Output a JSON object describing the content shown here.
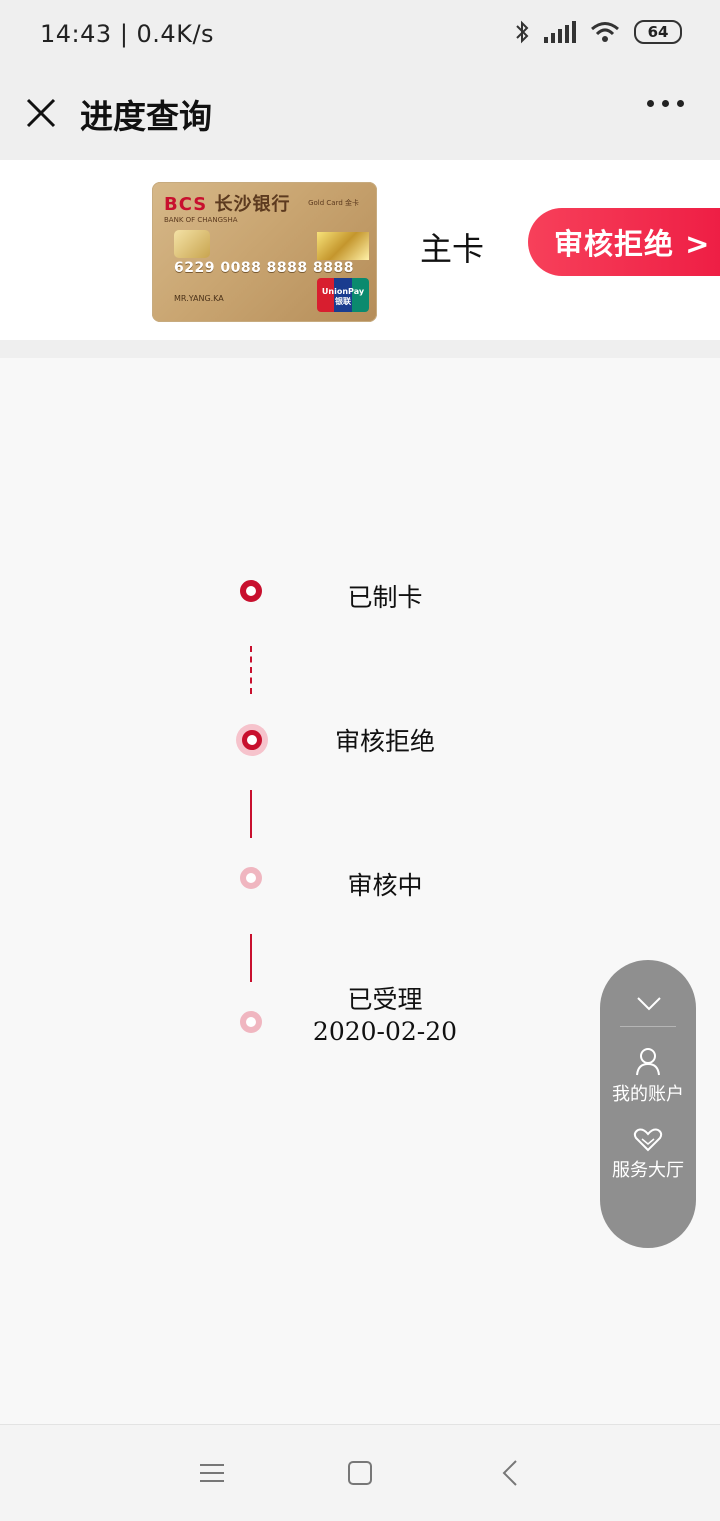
{
  "status_bar": {
    "time": "14:43",
    "network_speed": "0.4K/s",
    "battery": "64"
  },
  "header": {
    "title": "进度查询",
    "close_icon": "close-icon",
    "more_icon": "more-icon"
  },
  "card": {
    "bank_name": "长沙银行",
    "bank_code": "BCS",
    "bank_english": "BANK OF CHANGSHA",
    "card_level": "Gold Card 金卡",
    "card_number": "6229 0088 8888 8888",
    "holder": "MR.YANG.KA",
    "network": "UnionPay 银联",
    "card_type": "主卡",
    "status_label": "审核拒绝 >"
  },
  "timeline": [
    {
      "label": "已制卡",
      "date": ""
    },
    {
      "label": "审核拒绝",
      "date": ""
    },
    {
      "label": "审核中",
      "date": ""
    },
    {
      "label": "已受理",
      "date": "2020-02-20"
    }
  ],
  "float_menu": {
    "collapse_icon": "chevron-down-icon",
    "items": [
      {
        "label": "我的账户",
        "icon": "user-icon"
      },
      {
        "label": "服务大厅",
        "icon": "heart-icon"
      }
    ]
  },
  "colors": {
    "accent": "#c8102e",
    "pill": "#ee1d44",
    "muted_dot": "#f0b6c0"
  }
}
